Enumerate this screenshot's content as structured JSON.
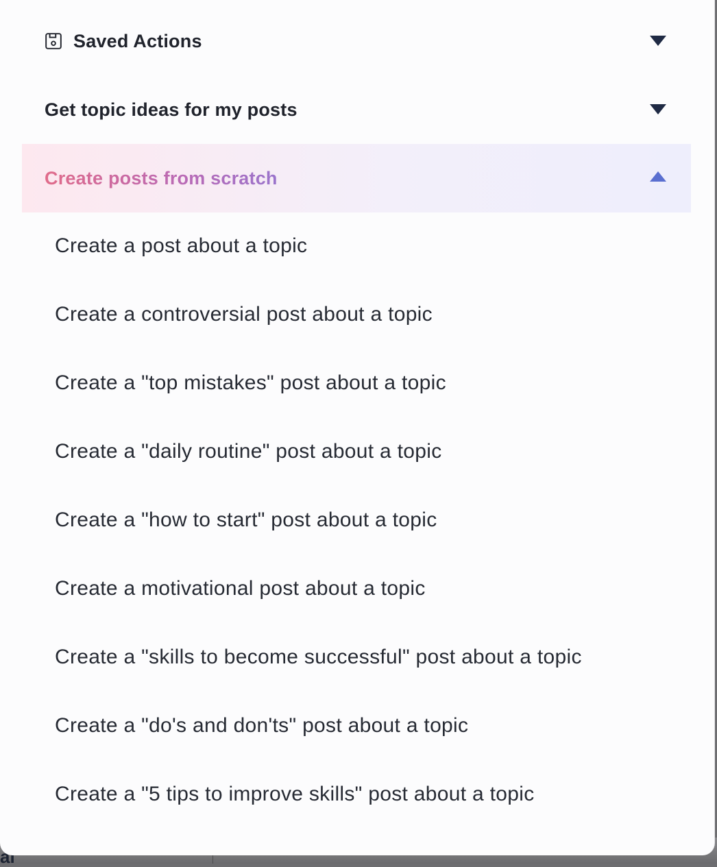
{
  "sections": {
    "saved": {
      "label": "Saved Actions",
      "icon": "save-icon",
      "state": "collapsed"
    },
    "topics": {
      "label": "Get topic ideas for my posts",
      "state": "collapsed"
    },
    "scratch": {
      "label": "Create posts from scratch",
      "state": "expanded"
    }
  },
  "scratch_items": [
    "Create a post about a topic",
    "Create a controversial post about a topic",
    "Create a \"top mistakes\" post about a topic",
    "Create a \"daily routine\" post about a topic",
    "Create a \"how to start\" post about a topic",
    "Create a motivational post about a topic",
    "Create a \"skills to become successful\" post about a topic",
    "Create a \"do's and don'ts\" post about a topic",
    "Create a \"5 tips to improve skills\" post about a topic"
  ],
  "backdrop_text": "al",
  "colors": {
    "chevron_dark": "#1f2a44",
    "chevron_active": "#5a6fd0",
    "active_bg_start": "#fde8ef",
    "active_bg_end": "#eeeefc",
    "active_text_start": "#e06b8a",
    "active_text_end": "#9a74cc"
  }
}
